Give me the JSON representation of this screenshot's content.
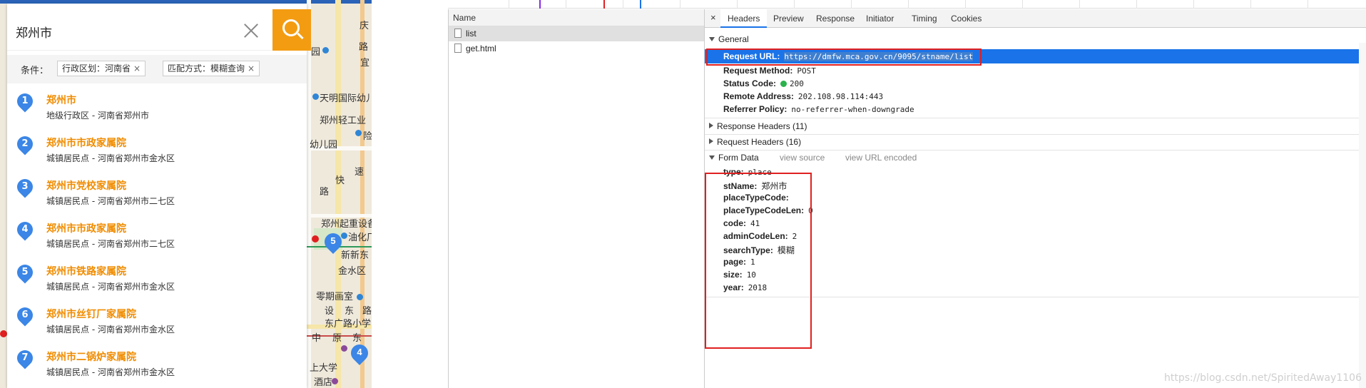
{
  "map": {
    "labels": [
      "天明国际幼儿",
      "郑州轻工业",
      "幼儿园",
      "快",
      "速",
      "路",
      "郑州起重设备",
      "油化厂",
      "新新东",
      "金水区",
      "零期画室",
      "设",
      "东",
      "路",
      "东广路小学",
      "中",
      "原",
      "东",
      "上大学",
      "酒店",
      "庆",
      "路",
      "宜",
      "园",
      "险"
    ],
    "markers": [
      "5",
      "4"
    ]
  },
  "search": {
    "query": "郑州市",
    "filter_label": "条件：",
    "chips": [
      "行政区划：河南省",
      "匹配方式：模糊查询"
    ],
    "chip_close": "×"
  },
  "results": [
    {
      "num": "1",
      "title": "郑州市",
      "sub": "地级行政区 - 河南省郑州市"
    },
    {
      "num": "2",
      "title": "郑州市市政家属院",
      "sub": "城镇居民点 - 河南省郑州市金水区"
    },
    {
      "num": "3",
      "title": "郑州市党校家属院",
      "sub": "城镇居民点 - 河南省郑州市二七区"
    },
    {
      "num": "4",
      "title": "郑州市市政家属院",
      "sub": "城镇居民点 - 河南省郑州市二七区"
    },
    {
      "num": "5",
      "title": "郑州市铁路家属院",
      "sub": "城镇居民点 - 河南省郑州市金水区"
    },
    {
      "num": "6",
      "title": "郑州市丝钉厂家属院",
      "sub": "城镇居民点 - 河南省郑州市金水区"
    },
    {
      "num": "7",
      "title": "郑州市二锅炉家属院",
      "sub": "城镇居民点 - 河南省郑州市金水区"
    }
  ],
  "network": {
    "name_header": "Name",
    "requests": [
      {
        "name": "list",
        "selected": true
      },
      {
        "name": "get.html",
        "selected": false
      }
    ]
  },
  "details": {
    "close": "×",
    "tabs": [
      "Headers",
      "Preview",
      "Response",
      "Initiator",
      "Timing",
      "Cookies"
    ],
    "active_tab": "Headers",
    "general": {
      "title": "General",
      "request_url_key": "Request URL:",
      "request_url": "https://dmfw.mca.gov.cn/9095/stname/list",
      "method_key": "Request Method:",
      "method": "POST",
      "status_key": "Status Code:",
      "status": "200",
      "remote_key": "Remote Address:",
      "remote": "202.108.98.114:443",
      "referrer_key": "Referrer Policy:",
      "referrer": "no-referrer-when-downgrade"
    },
    "response_headers": "Response Headers (11)",
    "request_headers": "Request Headers (16)",
    "form_data": {
      "title": "Form Data",
      "view_source": "view source",
      "view_url_encoded": "view URL encoded",
      "fields": [
        {
          "k": "type:",
          "v": "place"
        },
        {
          "k": "stName:",
          "v": "郑州市"
        },
        {
          "k": "placeTypeCode:",
          "v": ""
        },
        {
          "k": "placeTypeCodeLen:",
          "v": "0"
        },
        {
          "k": "code:",
          "v": "41"
        },
        {
          "k": "adminCodeLen:",
          "v": "2"
        },
        {
          "k": "searchType:",
          "v": "模糊"
        },
        {
          "k": "page:",
          "v": "1"
        },
        {
          "k": "size:",
          "v": "10"
        },
        {
          "k": "year:",
          "v": "2018"
        }
      ]
    }
  },
  "watermark": "https://blog.csdn.net/SpiritedAway1106",
  "colors": {
    "accent": "#f39c12",
    "result_title": "#f08c00",
    "devtools_blue": "#1a73e8",
    "annotation_red": "#e02020"
  }
}
